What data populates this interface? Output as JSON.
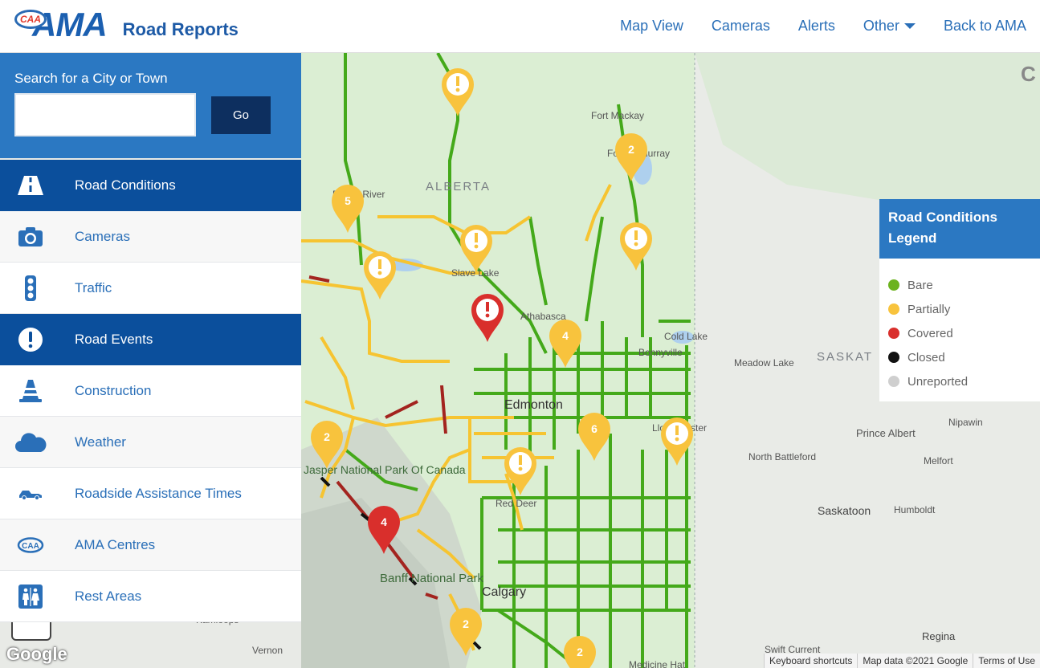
{
  "header": {
    "logo_caa": "CAA",
    "logo_ama": "AMA",
    "site_title": "Road Reports",
    "nav": [
      "Map View",
      "Cameras",
      "Alerts",
      "Other",
      "Back to AMA"
    ]
  },
  "search": {
    "label": "Search for a City or Town",
    "value": "",
    "button": "Go"
  },
  "sidebar": {
    "items": [
      {
        "label": "Road Conditions",
        "icon": "road-icon",
        "active": true
      },
      {
        "label": "Cameras",
        "icon": "camera-icon"
      },
      {
        "label": "Traffic",
        "icon": "traffic-light-icon"
      },
      {
        "label": "Road Events",
        "icon": "alert-icon",
        "active": true
      },
      {
        "label": "Construction",
        "icon": "construction-cone-icon"
      },
      {
        "label": "Weather",
        "icon": "cloud-icon"
      },
      {
        "label": "Roadside Assistance Times",
        "icon": "tow-truck-icon"
      },
      {
        "label": "AMA Centres",
        "icon": "caa-icon"
      },
      {
        "label": "Rest Areas",
        "icon": "restroom-icon"
      }
    ]
  },
  "legend": {
    "title": "Road Conditions Legend",
    "items": [
      {
        "label": "Bare",
        "color": "#6cb31e"
      },
      {
        "label": "Partially",
        "color": "#f8c33d"
      },
      {
        "label": "Covered",
        "color": "#d92f2c"
      },
      {
        "label": "Closed",
        "color": "#111111"
      },
      {
        "label": "Unreported",
        "color": "#cfcfcf"
      }
    ]
  },
  "map": {
    "labels": {
      "alberta": "ALBERTA",
      "saskat": "SASKAT",
      "fort_mackay": "Fort Mackay",
      "fort_mcmurray": "Fort McMurray",
      "peace_river": "Peace River",
      "slave_lake": "Slave Lake",
      "athabasca": "Athabasca",
      "cold_lake": "Cold Lake",
      "bonnyville": "Bonnyville",
      "meadow_lake": "Meadow Lake",
      "edmonton": "Edmonton",
      "lloydminster": "Lloydminster",
      "nipawin": "Nipawin",
      "prince_albert": "Prince Albert",
      "north_battleford": "North Battleford",
      "melfort": "Melfort",
      "red_deer": "Red Deer",
      "jasper": "Jasper National Park Of Canada",
      "saskatoon": "Saskatoon",
      "humboldt": "Humboldt",
      "banff": "Banff National Park",
      "calgary": "Calgary",
      "kamloops": "Kamloops",
      "vernon": "Vernon",
      "regina": "Regina",
      "swift_current": "Swift Current",
      "medicine_hat": "Medicine Hat",
      "c": "C"
    },
    "markers": [
      {
        "type": "alert",
        "color": "#f8c33d",
        "label": ""
      },
      {
        "type": "count",
        "color": "#f8c33d",
        "label": "2"
      },
      {
        "type": "count",
        "color": "#f8c33d",
        "label": "5"
      },
      {
        "type": "alert",
        "color": "#f8c33d",
        "label": ""
      },
      {
        "type": "alert",
        "color": "#f8c33d",
        "label": ""
      },
      {
        "type": "alert",
        "color": "#f8c33d",
        "label": ""
      },
      {
        "type": "alert",
        "color": "#d92f2c",
        "label": ""
      },
      {
        "type": "count",
        "color": "#f8c33d",
        "label": "4"
      },
      {
        "type": "count",
        "color": "#f8c33d",
        "label": "6"
      },
      {
        "type": "alert",
        "color": "#f8c33d",
        "label": ""
      },
      {
        "type": "count",
        "color": "#f8c33d",
        "label": "2"
      },
      {
        "type": "alert",
        "color": "#f8c33d",
        "label": ""
      },
      {
        "type": "count",
        "color": "#d92f2c",
        "label": "4"
      },
      {
        "type": "count",
        "color": "#f8c33d",
        "label": "2"
      },
      {
        "type": "count",
        "color": "#f8c33d",
        "label": "2"
      }
    ],
    "google_logo": "Google",
    "attribution": [
      "Keyboard shortcuts",
      "Map data ©2021 Google",
      "Terms of Use"
    ]
  }
}
